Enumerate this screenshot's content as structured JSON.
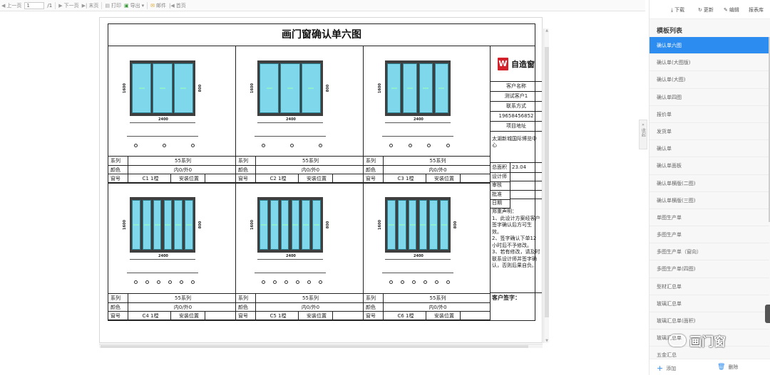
{
  "toolbar": {
    "prev_page": "上一页",
    "page_input": "1",
    "page_total": "/1",
    "next_page": "下一页",
    "last_page": "末页",
    "print": "打印",
    "export": "导出",
    "mail": "邮件",
    "first_page": "首页"
  },
  "document": {
    "title": "画门窗确认单六图",
    "windows": [
      {
        "width_label": "2400",
        "height_label": "1600",
        "height2_label": "800",
        "series_label": "系列",
        "series_value": "55系列",
        "color_label": "颜色",
        "color_value": "内0/外0",
        "number_label": "窗号",
        "number_value": "C1 1樘",
        "install_label": "安装位置"
      },
      {
        "width_label": "2400",
        "height_label": "1600",
        "height2_label": "800",
        "series_label": "系列",
        "series_value": "55系列",
        "color_label": "颜色",
        "color_value": "内0/外0",
        "number_label": "窗号",
        "number_value": "C2 1樘",
        "install_label": "安装位置"
      },
      {
        "width_label": "2400",
        "height_label": "1600",
        "height2_label": "",
        "series_label": "系列",
        "series_value": "55系列",
        "color_label": "颜色",
        "color_value": "内0/外0",
        "number_label": "窗号",
        "number_value": "C3 1樘",
        "install_label": "安装位置"
      },
      {
        "width_label": "2400",
        "height_label": "1600",
        "height2_label": "800",
        "series_label": "系列",
        "series_value": "55系列",
        "color_label": "颜色",
        "color_value": "内0/外0",
        "number_label": "窗号",
        "number_value": "C4 1樘",
        "install_label": "安装位置"
      },
      {
        "width_label": "2400",
        "height_label": "1600",
        "height2_label": "800",
        "series_label": "系列",
        "series_value": "55系列",
        "color_label": "颜色",
        "color_value": "内0/外0",
        "number_label": "窗号",
        "number_value": "C5 1樘",
        "install_label": "安装位置"
      },
      {
        "width_label": "2400",
        "height_label": "1600",
        "height2_label": "800",
        "series_label": "系列",
        "series_value": "55系列",
        "color_label": "颜色",
        "color_value": "内0/外0",
        "number_label": "窗号",
        "number_value": "C6 1樘",
        "install_label": "安装位置"
      }
    ],
    "side": {
      "logo_letter": "W",
      "logo_text": "自造窗",
      "customer_name_label": "客户名称",
      "customer_name": "测试客户1",
      "contact_label": "联系方式",
      "contact": "19658456852",
      "address_label": "项目地址",
      "address": "太湖新城国际博览中心",
      "total_area_label": "总面积",
      "total_area": "23.04",
      "designer_label": "设计师",
      "review_label": "审核",
      "approve_label": "批准",
      "date_label": "日期",
      "statement": "郑重声明：\n1、此设计方案经客户签字确认后方可生效。\n2、签字确认下单12小时后不予修改。\n3、若有修改，请及时联系设计师并签字确认，否则后果自负。",
      "signature_label": "客户签字："
    }
  },
  "collapse": {
    "label": "收起"
  },
  "right_panel": {
    "actions": {
      "download": "下载",
      "refresh": "更新",
      "edit": "编辑",
      "report_lib": "报表库"
    },
    "title": "模板列表",
    "items": [
      "确认单六图",
      "确认单(大图版)",
      "确认单(大图)",
      "确认单四图",
      "报价单",
      "发货单",
      "确认单",
      "确认单面板",
      "确认单横版(二图)",
      "确认单横版(三图)",
      "单图生产单",
      "多图生产单",
      "多图生产单（窗向）",
      "多图生产单(四图)",
      "型材汇总单",
      "玻璃汇总单",
      "玻璃汇总单(面积)",
      "玻璃汇总单",
      "五金汇总"
    ],
    "add_label": "添加",
    "delete_label": "删除"
  },
  "watermark": {
    "text": "画门窗"
  },
  "colors": {
    "accent": "#2d8cf0",
    "glass": "#7ed7ea",
    "frame": "#3f3f3f",
    "logo_red": "#d3202b"
  }
}
